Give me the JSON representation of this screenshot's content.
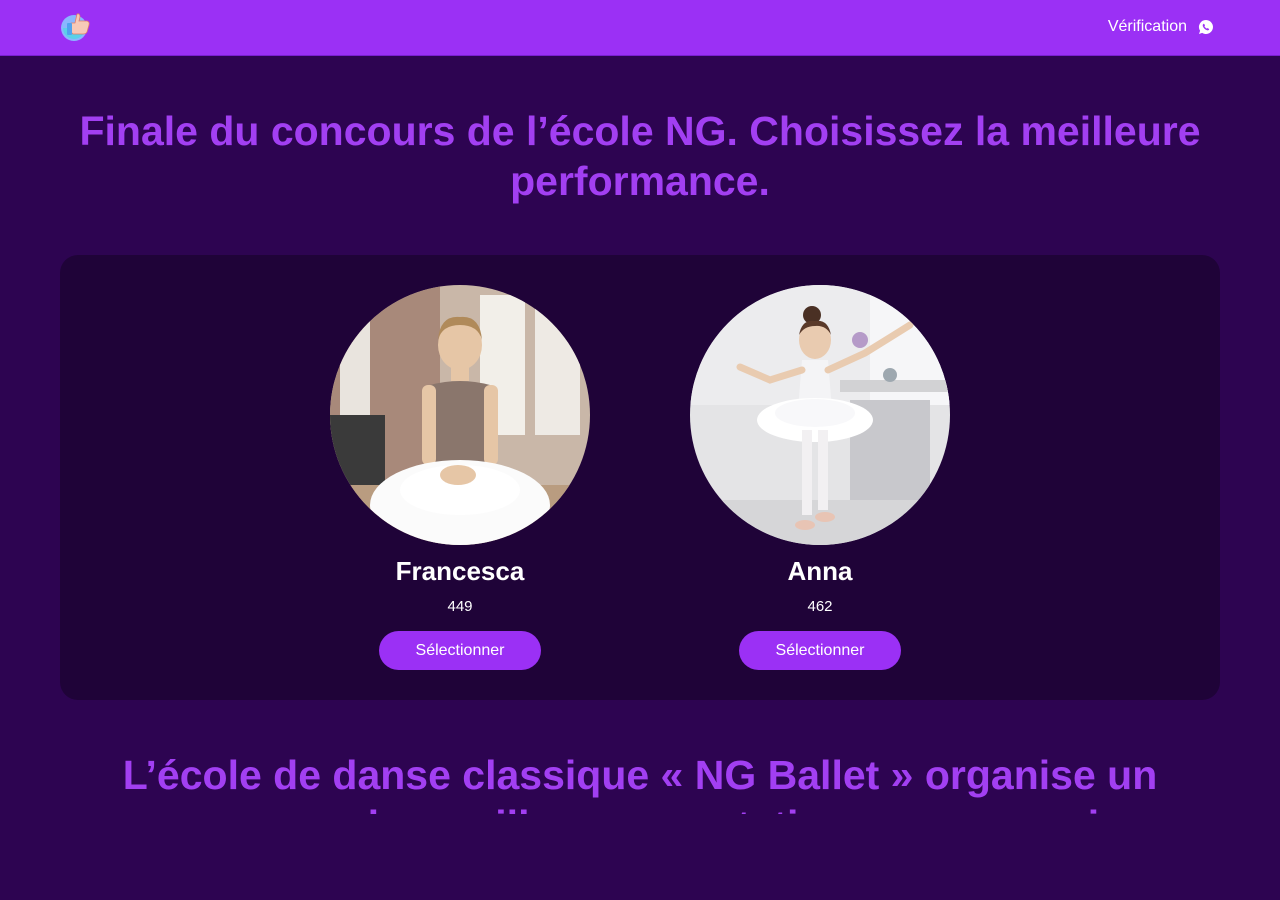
{
  "header": {
    "verification_label": "Vérification",
    "logo_icon": "thumbs-up-logo-icon",
    "verification_icon": "whatsapp-icon"
  },
  "main": {
    "title": "Finale du concours de l’école NG. Choisissez la meilleure performance.",
    "contestants": [
      {
        "name": "Francesca",
        "votes": "449",
        "button_label": "Sélectionner",
        "photo": "ballerina-seated-photo"
      },
      {
        "name": "Anna",
        "votes": "462",
        "button_label": "Sélectionner",
        "photo": "ballerina-dancing-photo"
      }
    ],
    "description": "L’école de danse classique « NG Ballet » organise un concours des meilleures prestations avec un prix"
  },
  "colors": {
    "background": "#2d0451",
    "header": "#9b30f5",
    "accent_text": "#a23ff2",
    "panel": "#1f0338",
    "button": "#9b30f5"
  }
}
